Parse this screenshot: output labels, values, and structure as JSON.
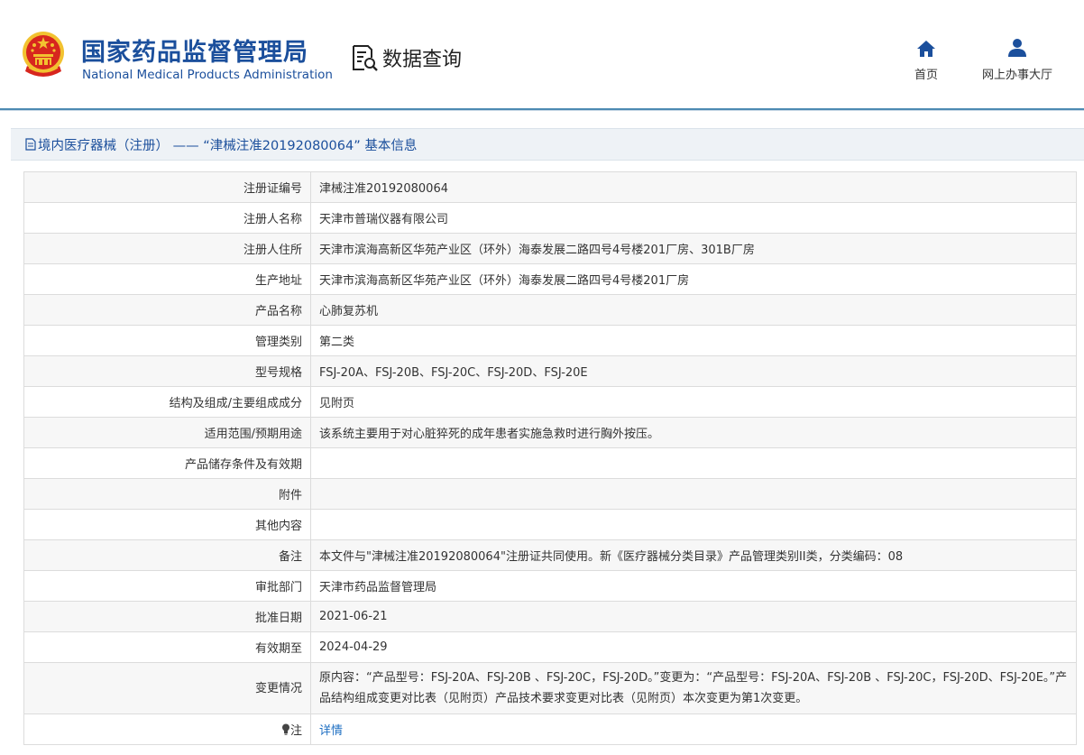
{
  "header": {
    "agency_cn": "国家药品监督管理局",
    "agency_en": "National Medical Products Administration",
    "emblem_icon": "national-emblem-icon",
    "query_title": "数据查询",
    "query_icon": "document-search-icon",
    "nav": [
      {
        "label": "首页",
        "icon": "home-icon"
      },
      {
        "label": "网上办事大厅",
        "icon": "user-icon"
      }
    ]
  },
  "page_title": "境内医疗器械（注册） ——  “津械注准20192080064” 基本信息",
  "rows": [
    {
      "label": "注册证编号",
      "value": "津械注准20192080064"
    },
    {
      "label": "注册人名称",
      "value": "天津市普瑞仪器有限公司"
    },
    {
      "label": "注册人住所",
      "value": "天津市滨海高新区华苑产业区（环外）海泰发展二路四号4号楼201厂房、301B厂房"
    },
    {
      "label": "生产地址",
      "value": "天津市滨海高新区华苑产业区（环外）海泰发展二路四号4号楼201厂房"
    },
    {
      "label": "产品名称",
      "value": "心肺复苏机"
    },
    {
      "label": "管理类别",
      "value": "第二类"
    },
    {
      "label": "型号规格",
      "value": "FSJ-20A、FSJ-20B、FSJ-20C、FSJ-20D、FSJ-20E"
    },
    {
      "label": "结构及组成/主要组成成分",
      "value": "见附页"
    },
    {
      "label": "适用范围/预期用途",
      "value": "该系统主要用于对心脏猝死的成年患者实施急救时进行胸外按压。"
    },
    {
      "label": "产品储存条件及有效期",
      "value": ""
    },
    {
      "label": "附件",
      "value": ""
    },
    {
      "label": "其他内容",
      "value": ""
    },
    {
      "label": "备注",
      "value": "本文件与\"津械注准20192080064\"注册证共同使用。新《医疗器械分类目录》产品管理类别II类，分类编码：08"
    },
    {
      "label": "审批部门",
      "value": "天津市药品监督管理局"
    },
    {
      "label": "批准日期",
      "value": "2021-06-21"
    },
    {
      "label": "有效期至",
      "value": "2024-04-29"
    },
    {
      "label": "变更情况",
      "value": "原内容：“产品型号：FSJ-20A、FSJ-20B 、FSJ-20C，FSJ-20D。”变更为：“产品型号：FSJ-20A、FSJ-20B 、FSJ-20C，FSJ-20D、FSJ-20E。”产品结构组成变更对比表（见附页）产品技术要求变更对比表（见附页）本次变更为第1次变更。"
    }
  ],
  "note_row": {
    "label": "注",
    "icon": "lightbulb-icon",
    "link": "详情"
  },
  "colors": {
    "brand_blue": "#1b4f9c",
    "link_blue": "#1e6fc2",
    "emblem_red": "#d7261e",
    "emblem_gold": "#f2c230"
  }
}
